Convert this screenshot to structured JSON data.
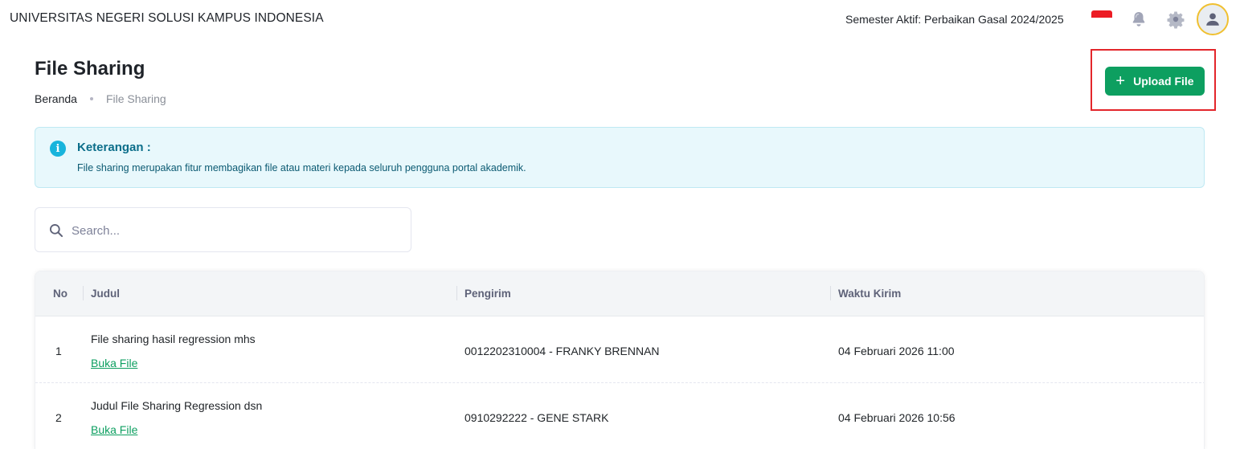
{
  "header": {
    "university_name": "UNIVERSITAS NEGERI SOLUSI KAMPUS INDONESIA",
    "semester_label": "Semester Aktif: Perbaikan Gasal 2024/2025",
    "icons": [
      "indonesia-flag-icon",
      "bell-icon",
      "gear-icon",
      "user-avatar-icon"
    ]
  },
  "page": {
    "title": "File Sharing",
    "breadcrumb": {
      "home": "Beranda",
      "current": "File Sharing"
    }
  },
  "toolbar": {
    "upload_label": "Upload File",
    "accent_color": "#0d9f60",
    "highlight_color": "#e3262b"
  },
  "alert": {
    "title": "Keterangan :",
    "text": "File sharing merupakan fitur membagikan file atau materi kepada seluruh pengguna portal akademik."
  },
  "search": {
    "placeholder": "Search..."
  },
  "table": {
    "headers": {
      "no": "No",
      "judul": "Judul",
      "pengirim": "Pengirim",
      "waktu": "Waktu Kirim"
    },
    "rows": [
      {
        "no": "1",
        "judul": "File sharing hasil regression mhs",
        "link": "Buka File",
        "pengirim": "0012202310004 - FRANKY BRENNAN",
        "waktu": "04 Februari 2026 11:00"
      },
      {
        "no": "2",
        "judul": "Judul File Sharing Regression dsn",
        "link": "Buka File",
        "pengirim": "0910292222 - GENE STARK",
        "waktu": "04 Februari 2026 10:56"
      }
    ]
  }
}
